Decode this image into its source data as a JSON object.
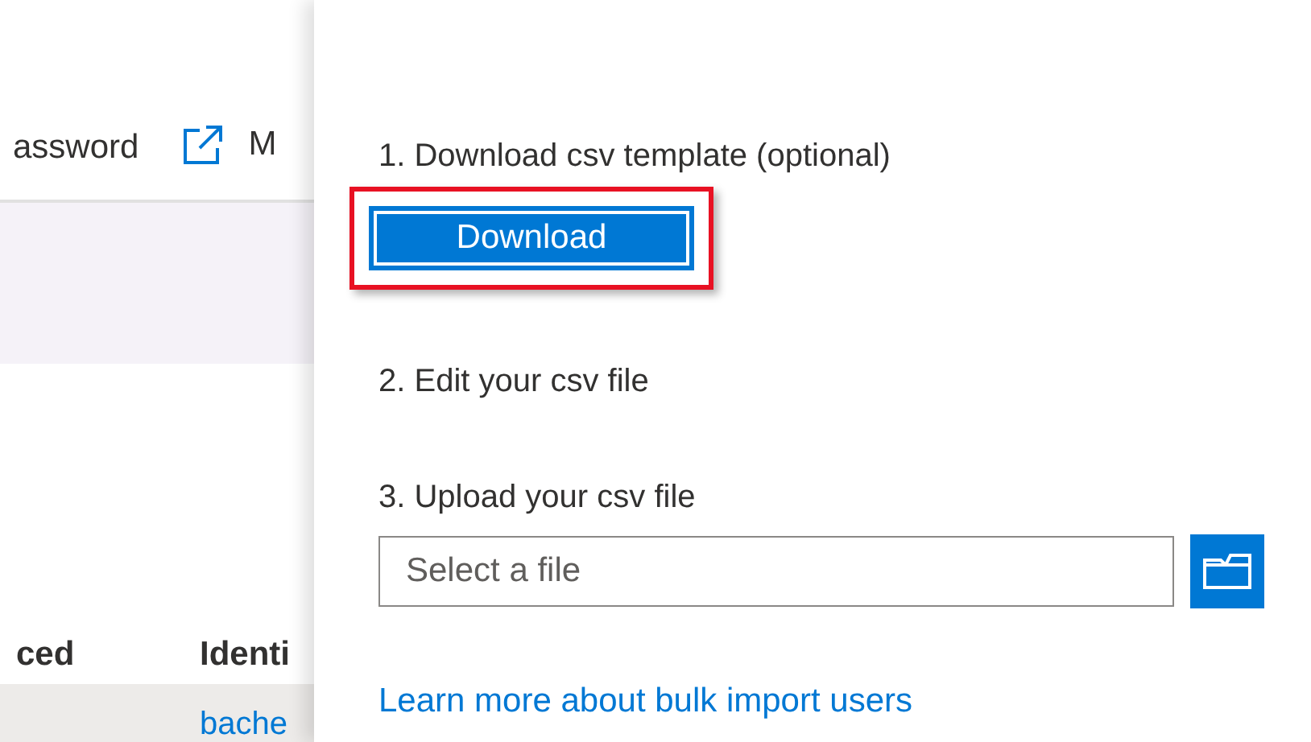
{
  "background_page": {
    "toolbar": [
      {
        "kind": "text",
        "label": "assword"
      },
      {
        "kind": "external-link",
        "label": "M"
      }
    ],
    "table": {
      "columns": [
        "ced",
        "Identi"
      ],
      "rows": [
        {
          "cells": [
            "",
            "bache"
          ]
        }
      ]
    }
  },
  "panel": {
    "steps": [
      {
        "label": "1. Download csv template (optional)",
        "button": {
          "label": "Download",
          "highlighted": true
        }
      },
      {
        "label": "2. Edit your csv file"
      },
      {
        "label": "3. Upload your csv file",
        "file_field": {
          "placeholder": "Select a file"
        }
      }
    ],
    "link": "Learn more about bulk import users"
  }
}
